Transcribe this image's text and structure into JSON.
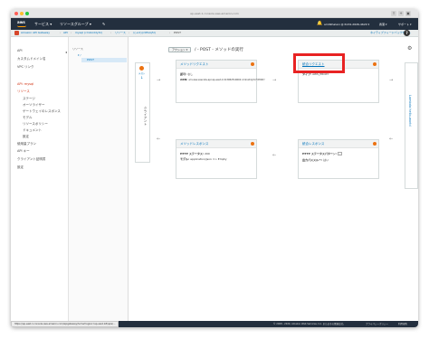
{
  "browser": {
    "url": "ap-east-1.console.aws.amazon.com"
  },
  "navbar": {
    "logo": "aws",
    "services": "サービス ▾",
    "resource_groups": "リソースグループ ▾",
    "pin": "✎",
    "account": "amitkhalani @ 6134-2626-4620 ▾",
    "region": "香港 ▾",
    "support": "サポート ▾"
  },
  "breadcrumb": {
    "items": [
      "Amazon API Gateway",
      "API",
      "mysql (cmkxiddy3c)",
      "リソース",
      "/{+id}(r0fbzq5l)",
      "POST"
    ],
    "feedback": "ネイティブフィードバックを送る",
    "help": "?"
  },
  "sidebar": {
    "items": [
      {
        "label": "API",
        "active": false,
        "sub": false
      },
      {
        "label": "カスタムドメイン名",
        "active": false,
        "sub": false
      },
      {
        "label": "VPC リンク",
        "active": false,
        "sub": false
      },
      {
        "label": "API: mysql",
        "active": true,
        "sub": false
      },
      {
        "label": "リソース",
        "active": true,
        "sub": false
      },
      {
        "label": "ステージ",
        "active": false,
        "sub": true
      },
      {
        "label": "オーソライザー",
        "active": false,
        "sub": true
      },
      {
        "label": "ゲートウェイのレスポンス",
        "active": false,
        "sub": true
      },
      {
        "label": "モデル",
        "active": false,
        "sub": true
      },
      {
        "label": "リソースポリシー",
        "active": false,
        "sub": true
      },
      {
        "label": "ドキュメント",
        "active": false,
        "sub": true
      },
      {
        "label": "設定",
        "active": false,
        "sub": true
      },
      {
        "label": "使用量プラン",
        "active": false,
        "sub": false
      },
      {
        "label": "API キー",
        "active": false,
        "sub": false
      },
      {
        "label": "クライアント証明書",
        "active": false,
        "sub": false
      },
      {
        "label": "設定",
        "active": false,
        "sub": false
      }
    ],
    "collapse": "◂"
  },
  "tree": {
    "label": "リソース",
    "root": "▾ /",
    "selected": "POST"
  },
  "main": {
    "actions": "アクション ▾",
    "title": "/ - POST - メソッドの実行",
    "settings_icon": "gear-icon"
  },
  "client": {
    "test": "テスト",
    "label": "クライアント"
  },
  "method_request": {
    "title": "メソッドリクエスト",
    "auth_label": "認可:",
    "auth_value": "なし",
    "arn_label": "ARN:",
    "arn_value": "arn:aws:execute-api:ap-east-1:013082510602:cmkxiddy3c/*/POST/"
  },
  "integration_request": {
    "title": "統合リクエスト",
    "type_label": "タイプ:",
    "type_value": "AWS_PROXY"
  },
  "method_response": {
    "title": "メソッドレスポンス",
    "status_label": "HTTP ステータス:",
    "status_value": "200",
    "model_label": "モデル:",
    "model_value": "application/json => Empty"
  },
  "integration_response": {
    "title": "統合レスポンス",
    "status_label": "HTTP ステータスパターン:",
    "status_value": "-",
    "output_label": "出力パススルー:",
    "output_value": "はい"
  },
  "backend": {
    "label": "Lambda hello-world"
  },
  "footer": {
    "status_url": "https://ap-east-1.console.aws.amazon.com/apigateway/home?region=ap-east-1#/apis/...",
    "copyright": "© 2008 - 2020, Amazon Web Services, Inc. またはその関連会社。",
    "privacy": "プライバシーポリシー",
    "terms": "利用規約"
  },
  "colors": {
    "navbar": "#232f3e",
    "accent": "#ec7211",
    "link": "#0073bb",
    "highlight": "#e82323"
  }
}
